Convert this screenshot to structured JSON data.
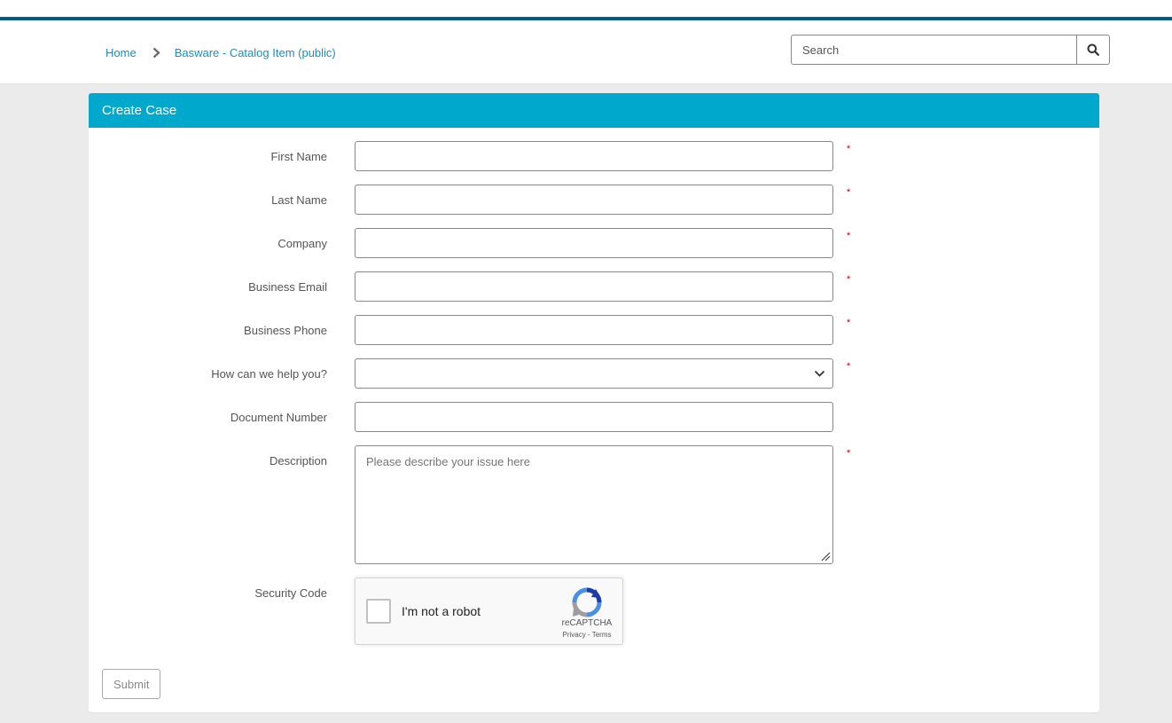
{
  "breadcrumb": {
    "home": "Home",
    "current": "Basware - Catalog Item (public)"
  },
  "search": {
    "placeholder": "Search"
  },
  "panel": {
    "title": "Create Case"
  },
  "form": {
    "first_name": {
      "label": "First Name",
      "required": "*"
    },
    "last_name": {
      "label": "Last Name",
      "required": "*"
    },
    "company": {
      "label": "Company",
      "required": "*"
    },
    "business_email": {
      "label": "Business Email",
      "required": "*"
    },
    "business_phone": {
      "label": "Business Phone",
      "required": "*"
    },
    "help": {
      "label": "How can we help you?",
      "required": "*",
      "selected": ""
    },
    "document_number": {
      "label": "Document Number"
    },
    "description": {
      "label": "Description",
      "required": "*",
      "placeholder": "Please describe your issue here"
    },
    "security_code": {
      "label": "Security Code"
    }
  },
  "recaptcha": {
    "checkbox_label": "I'm not a robot",
    "brand": "reCAPTCHA",
    "privacy": "Privacy",
    "separator": " - ",
    "terms": "Terms"
  },
  "submit_label": "Submit",
  "colors": {
    "header_accent": "#005e80",
    "panel_header": "#00a8cc",
    "link": "#1a8fc0",
    "required": "#cc0000"
  }
}
